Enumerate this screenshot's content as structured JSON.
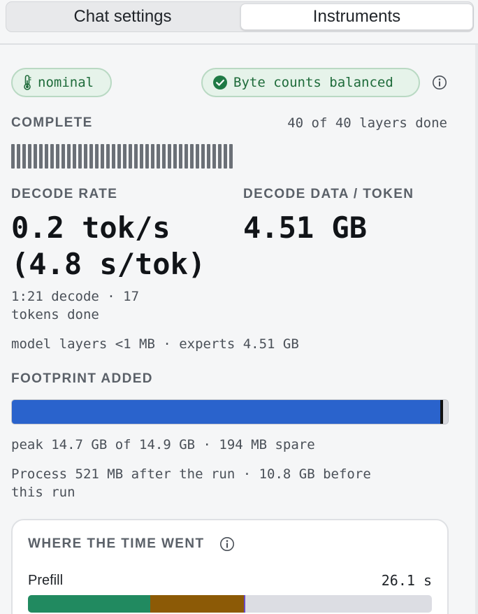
{
  "tabs": [
    {
      "label": "Chat settings",
      "active": false
    },
    {
      "label": "Instruments",
      "active": true
    }
  ],
  "status": {
    "thermal_label": "nominal",
    "balance_label": "Byte counts balanced",
    "accent_color": "#1e6b3a"
  },
  "progress": {
    "state_label": "COMPLETE",
    "layers_text": "40 of 40 layers done",
    "layers_done": 40,
    "layers_total": 40
  },
  "decode": {
    "rate_label": "DECODE RATE",
    "rate_value": "0.2 tok/s",
    "rate_secondary": "(4.8 s/tok)",
    "rate_meta_line1": "1:21 decode · 17",
    "rate_meta_line2": "tokens done",
    "data_label": "DECODE DATA / TOKEN",
    "data_value": "4.51 GB",
    "breakdown": "model layers <1 MB · experts 4.51 GB"
  },
  "footprint": {
    "label": "FOOTPRINT ADDED",
    "fill_fraction": 0.987,
    "peak_fraction": 0.988,
    "bar_color": "#2a63cc",
    "summary": "peak 14.7 GB of 14.9 GB · 194 MB spare",
    "process_line1": "Process 521 MB after the run · 10.8 GB before",
    "process_line2": "this run"
  },
  "time": {
    "title": "WHERE THE TIME WENT",
    "rows": [
      {
        "label": "Prefill",
        "value": "26.1 s",
        "segments": [
          {
            "fraction": 0.302,
            "color": "#218a60"
          },
          {
            "fraction": 0.233,
            "color": "#8c5a06"
          },
          {
            "fraction": 0.003,
            "color": "#6a4bc4"
          }
        ]
      }
    ]
  }
}
